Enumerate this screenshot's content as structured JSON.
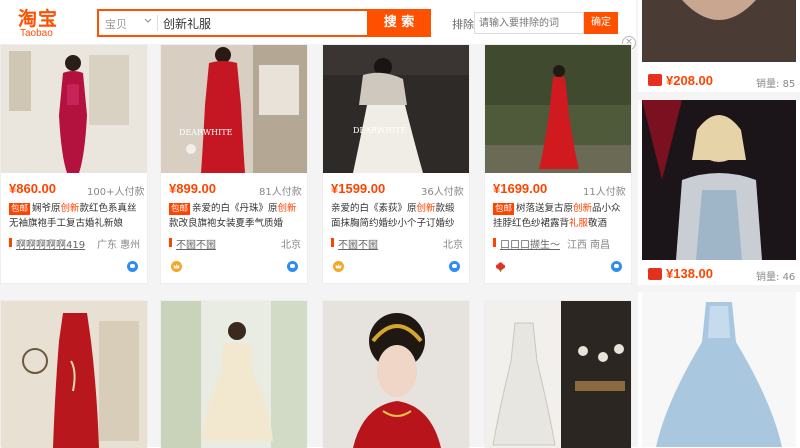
{
  "header": {
    "logo_cn": "淘宝",
    "logo_en": "Taobao",
    "search_scope": "宝贝",
    "search_query": "创新礼服",
    "search_button": "搜 索",
    "exclude_label": "排除",
    "exclude_placeholder": "请输入要排除的词",
    "exclude_button": "确定",
    "close_symbol": "×"
  },
  "row1": [
    {
      "price": "¥860.00",
      "payers": "100+人付款",
      "has_baoyou": true,
      "title_parts": [
        "娴爷原",
        "创新",
        "款红色系真丝无袖旗袍手工复古婚礼新娘"
      ],
      "shop": "啊啊啊啊啊419",
      "location": "广东 惠州",
      "badge": "none"
    },
    {
      "price": "¥899.00",
      "payers": "81人付款",
      "has_baoyou": true,
      "title_parts": [
        "亲爱的白《丹珠》原",
        "创新",
        "款改良旗袍女装夏季气质婚"
      ],
      "shop": "不圌不圌",
      "location": "北京",
      "badge": "crown"
    },
    {
      "price": "¥1599.00",
      "payers": "36人付款",
      "has_baoyou": false,
      "title_parts": [
        "亲爱的白《素荻》原",
        "创新",
        "款缎面抹胸简约婚纱小个子订婚纱"
      ],
      "shop": "不圌不圌",
      "location": "北京",
      "badge": "crown"
    },
    {
      "price": "¥1699.00",
      "payers": "11人付款",
      "has_baoyou": true,
      "title_parts": [
        "树落送复古原",
        "创新",
        "品小众挂脖红色纱裙露背",
        "礼服",
        "敬酒"
      ],
      "shop": "口口口撷生～",
      "location": "江西 南昌",
      "badge": "flower"
    }
  ],
  "right_column": [
    {
      "price": "¥208.00",
      "sold_label": "销量:",
      "sold": "85"
    },
    {
      "price": "¥138.00",
      "sold_label": "销量:",
      "sold": "46"
    }
  ],
  "colors": {
    "accent": "#ff5000",
    "price": "#ff4400",
    "wangwang": "#2f8cf0"
  },
  "icons": [
    "chevron-down-icon",
    "close-icon",
    "wangwang-chat-icon",
    "crown-badge-icon",
    "flower-badge-icon",
    "shopping-cart-icon",
    "shop-marker-icon"
  ]
}
